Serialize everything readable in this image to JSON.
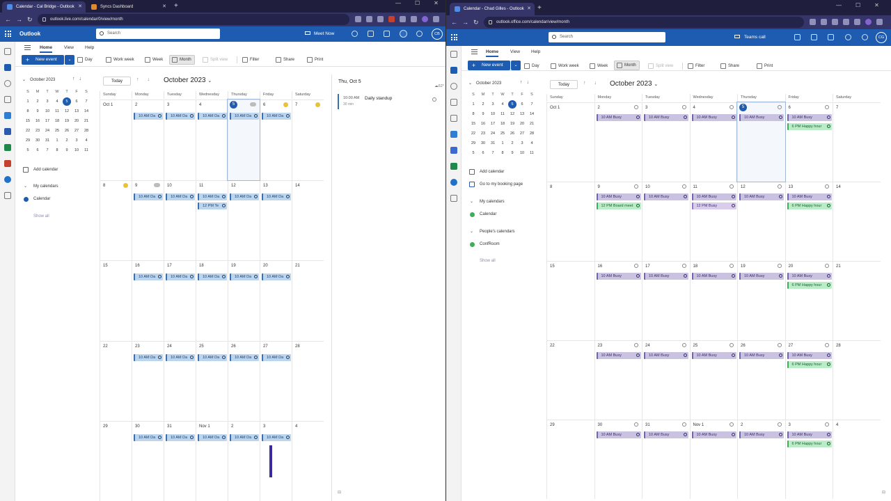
{
  "left": {
    "tabs": [
      {
        "label": "Calendar - Cal Bridge - Outlook",
        "active": true
      },
      {
        "label": "Syncs Dashboard",
        "active": false
      }
    ],
    "url": "outlook.live.com/calendar/0/view/month",
    "brand": "Outlook",
    "search_placeholder": "Search",
    "meet_now": "Meet Now",
    "avatar": "CB",
    "ribbon_tabs": [
      "Home",
      "View",
      "Help"
    ],
    "new_event": "New event",
    "toolbar": [
      "Day",
      "Work week",
      "Week",
      "Month",
      "Split view",
      "Filter",
      "Share",
      "Print"
    ],
    "mini_title": "October 2023",
    "mini_headers": [
      "S",
      "M",
      "T",
      "W",
      "T",
      "F",
      "S"
    ],
    "mini_days": [
      "1",
      "2",
      "3",
      "4",
      "5",
      "6",
      "7",
      "8",
      "9",
      "10",
      "11",
      "12",
      "13",
      "14",
      "15",
      "16",
      "17",
      "18",
      "19",
      "20",
      "21",
      "22",
      "23",
      "24",
      "25",
      "26",
      "27",
      "28",
      "29",
      "30",
      "31",
      "1",
      "2",
      "3",
      "4",
      "5",
      "6",
      "7",
      "8",
      "9",
      "10",
      "11"
    ],
    "add_calendar": "Add calendar",
    "my_calendars": "My calendars",
    "calendar_item": "Calendar",
    "show_all": "Show all",
    "today_btn": "Today",
    "month_title": "October 2023",
    "day_names": [
      "Sunday",
      "Monday",
      "Tuesday",
      "Wednesday",
      "Thursday",
      "Friday",
      "Saturday"
    ],
    "weeks": [
      [
        "Oct 1",
        "2",
        "3",
        "4",
        "5",
        "6",
        "7"
      ],
      [
        "8",
        "9",
        "10",
        "11",
        "12",
        "13",
        "14"
      ],
      [
        "15",
        "16",
        "17",
        "18",
        "19",
        "20",
        "21"
      ],
      [
        "22",
        "23",
        "24",
        "25",
        "26",
        "27",
        "28"
      ],
      [
        "29",
        "30",
        "31",
        "Nov 1",
        "2",
        "3",
        "4"
      ]
    ],
    "event_label": "10 AM Da",
    "event_extra": "12 PM Te",
    "panel_date": "Thu, Oct 5",
    "panel_temp": "62°",
    "panel_event_time": "10:00 AM",
    "panel_event_dur": "30 min",
    "panel_event_title": "Daily standup"
  },
  "right": {
    "tabs": [
      {
        "label": "Calendar - Chad Gilles - Outlook",
        "active": true
      }
    ],
    "url": "outlook.office.com/calendar/view/month",
    "search_placeholder": "Search",
    "teams_call": "Teams call",
    "avatar": "CG",
    "ribbon_tabs": [
      "Home",
      "View",
      "Help"
    ],
    "new_event": "New event",
    "toolbar": [
      "Day",
      "Work week",
      "Week",
      "Month",
      "Split view",
      "Filter",
      "Share",
      "Print"
    ],
    "mini_title": "October 2023",
    "mini_headers": [
      "S",
      "M",
      "T",
      "W",
      "T",
      "F",
      "S"
    ],
    "mini_days": [
      "1",
      "2",
      "3",
      "4",
      "5",
      "6",
      "7",
      "8",
      "9",
      "10",
      "11",
      "12",
      "13",
      "14",
      "15",
      "16",
      "17",
      "18",
      "19",
      "20",
      "21",
      "22",
      "23",
      "24",
      "25",
      "26",
      "27",
      "28",
      "29",
      "30",
      "31",
      "1",
      "2",
      "3",
      "4",
      "5",
      "6",
      "7",
      "8",
      "9",
      "10",
      "11"
    ],
    "add_calendar": "Add calendar",
    "booking_page": "Go to my booking page",
    "my_calendars": "My calendars",
    "calendar_item": "Calendar",
    "peoples_calendars": "People's calendars",
    "confroom": "ConfRoom",
    "show_all": "Show all",
    "today_btn": "Today",
    "month_title": "October 2023",
    "day_names": [
      "Sunday",
      "Monday",
      "Tuesday",
      "Wednesday",
      "Thursday",
      "Friday",
      "Saturday"
    ],
    "weeks": [
      [
        "Oct 1",
        "2",
        "3",
        "4",
        "5",
        "6",
        "7"
      ],
      [
        "8",
        "9",
        "10",
        "11",
        "12",
        "13",
        "14"
      ],
      [
        "15",
        "16",
        "17",
        "18",
        "19",
        "20",
        "21"
      ],
      [
        "22",
        "23",
        "24",
        "25",
        "26",
        "27",
        "28"
      ],
      [
        "29",
        "30",
        "31",
        "Nov 1",
        "2",
        "3",
        "4"
      ]
    ],
    "busy_label": "10 AM Busy",
    "busy_noon": "12 PM Busy",
    "board_meeting": "12 PM Board meet",
    "happy_hour": "6 PM Happy hour"
  }
}
